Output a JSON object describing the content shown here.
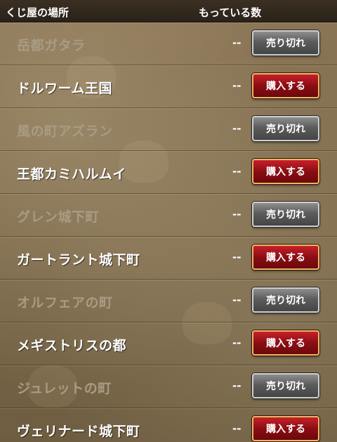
{
  "header": {
    "place_label": "くじ屋の場所",
    "count_label": "もっている数"
  },
  "rows": [
    {
      "name": "岳都ガタラ",
      "count": "--",
      "button": "売り切れ",
      "status": "soldout"
    },
    {
      "name": "ドルワーム王国",
      "count": "--",
      "button": "購入する",
      "status": "available"
    },
    {
      "name": "風の町アズラン",
      "count": "--",
      "button": "売り切れ",
      "status": "soldout"
    },
    {
      "name": "王都カミハルムイ",
      "count": "--",
      "button": "購入する",
      "status": "available"
    },
    {
      "name": "グレン城下町",
      "count": "--",
      "button": "売り切れ",
      "status": "soldout"
    },
    {
      "name": "ガートラント城下町",
      "count": "--",
      "button": "購入する",
      "status": "available"
    },
    {
      "name": "オルフェアの町",
      "count": "--",
      "button": "売り切れ",
      "status": "soldout"
    },
    {
      "name": "メギストリスの都",
      "count": "--",
      "button": "購入する",
      "status": "available"
    },
    {
      "name": "ジュレットの町",
      "count": "--",
      "button": "売り切れ",
      "status": "soldout"
    },
    {
      "name": "ヴェリナード城下町",
      "count": "--",
      "button": "購入する",
      "status": "available"
    }
  ],
  "colors": {
    "soldout_button": "#5c5c5c",
    "buy_button": "#8a0e14",
    "buy_border": "#e7b86a"
  }
}
